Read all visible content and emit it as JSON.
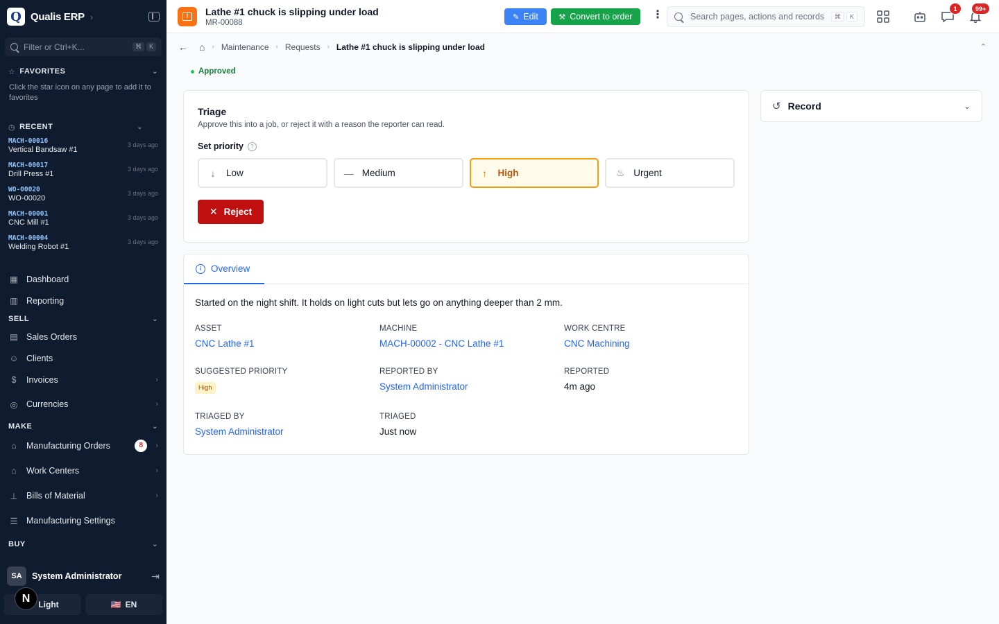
{
  "app": {
    "logo_letter": "Q",
    "name": "Qualis ERP"
  },
  "sidebar": {
    "filter_placeholder": "Filter or Ctrl+K...",
    "filter_keys": [
      "⌘",
      "K"
    ],
    "favorites": {
      "title": "FAVORITES",
      "hint": "Click the star icon on any page to add it to favorites"
    },
    "recent": {
      "title": "RECENT",
      "items": [
        {
          "code": "MACH-00016",
          "name": "Vertical Bandsaw #1",
          "ago": "3 days ago"
        },
        {
          "code": "MACH-00017",
          "name": "Drill Press #1",
          "ago": "3 days ago"
        },
        {
          "code": "WO-00020",
          "name": "WO-00020",
          "ago": "3 days ago"
        },
        {
          "code": "MACH-00001",
          "name": "CNC Mill #1",
          "ago": "3 days ago"
        },
        {
          "code": "MACH-00004",
          "name": "Welding Robot #1",
          "ago": "3 days ago"
        }
      ]
    },
    "nav_top": [
      {
        "label": "Dashboard",
        "icon": "dashboard-icon"
      },
      {
        "label": "Reporting",
        "icon": "chart-icon"
      }
    ],
    "sell": {
      "title": "SELL",
      "items": [
        {
          "label": "Sales Orders",
          "icon": "document-icon",
          "has_sub": false
        },
        {
          "label": "Clients",
          "icon": "users-icon",
          "has_sub": false
        },
        {
          "label": "Invoices",
          "icon": "invoice-icon",
          "has_sub": true
        },
        {
          "label": "Currencies",
          "icon": "coins-icon",
          "has_sub": true
        }
      ]
    },
    "make": {
      "title": "MAKE",
      "items": [
        {
          "label": "Manufacturing Orders",
          "icon": "factory-icon",
          "badge": "8",
          "has_sub": true
        },
        {
          "label": "Work Centers",
          "icon": "factory-icon",
          "has_sub": true
        },
        {
          "label": "Bills of Material",
          "icon": "hierarchy-icon",
          "has_sub": true
        },
        {
          "label": "Manufacturing Settings",
          "icon": "sliders-icon",
          "has_sub": false
        }
      ]
    },
    "buy": {
      "title": "BUY"
    },
    "user": {
      "initials": "SA",
      "name": "System Administrator"
    },
    "theme_label": "Light",
    "lang_label": "EN",
    "lang_flag": "🇺🇸",
    "n_badge": "N"
  },
  "topbar": {
    "record_title": "Lathe #1 chuck is slipping under load",
    "record_code": "MR-00088",
    "record_icon_mark": "!",
    "edit_label": "Edit",
    "convert_label": "Convert to order",
    "search_placeholder": "Search pages, actions and records",
    "search_keys": [
      "⌘",
      "K"
    ],
    "messages_badge": "1",
    "notifications_badge": "99+"
  },
  "breadcrumb": {
    "items": [
      "Maintenance",
      "Requests"
    ],
    "current": "Lathe #1 chuck is slipping under load"
  },
  "status": "Approved",
  "triage": {
    "title": "Triage",
    "description": "Approve this into a job, or reject it with a reason the reporter can read.",
    "priority_label": "Set priority",
    "priorities": [
      {
        "label": "Low",
        "icon": "↓"
      },
      {
        "label": "Medium",
        "icon": "—"
      },
      {
        "label": "High",
        "icon": "↑"
      },
      {
        "label": "Urgent",
        "icon": "♨"
      }
    ],
    "selected_priority": "High",
    "reject_label": "Reject"
  },
  "record_panel": {
    "title": "Record"
  },
  "overview": {
    "tab_label": "Overview",
    "description": "Started on the night shift. It holds on light cuts but lets go on anything deeper than 2 mm.",
    "fields": {
      "asset": {
        "label": "ASSET",
        "value": "CNC Lathe #1"
      },
      "machine": {
        "label": "MACHINE",
        "value": "MACH-00002 - CNC Lathe #1"
      },
      "work_centre": {
        "label": "WORK CENTRE",
        "value": "CNC Machining"
      },
      "suggested_priority": {
        "label": "SUGGESTED PRIORITY",
        "value": "High"
      },
      "reported_by": {
        "label": "REPORTED BY",
        "value": "System Administrator"
      },
      "reported": {
        "label": "REPORTED",
        "value": "4m ago"
      },
      "triaged_by": {
        "label": "TRIAGED BY",
        "value": "System Administrator"
      },
      "triaged": {
        "label": "TRIAGED",
        "value": "Just now"
      }
    }
  },
  "colors": {
    "sidebar_bg": "#0f1b2e",
    "accent": "#2563eb",
    "edit": "#3b82f6",
    "convert": "#16a34a",
    "reject": "#c00f0f",
    "priority_high": "#f59e0b"
  }
}
